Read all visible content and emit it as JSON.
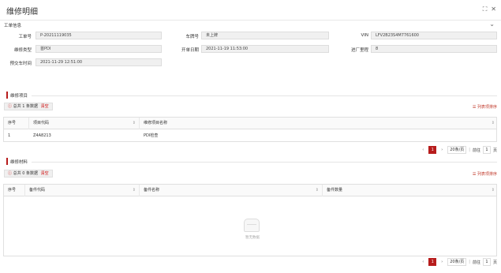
{
  "header": {
    "title": "维修明细"
  },
  "basic": {
    "section_title": "工单信息",
    "order_no_label": "工单号",
    "order_no": "P-20211119035",
    "plate_label": "车牌号",
    "plate": "未上牌",
    "vin_label": "VIN",
    "vin": "LFV2B23S4M7761600",
    "repair_type_label": "维修类型",
    "repair_type": "首PDI",
    "open_date_label": "开单日期",
    "open_date": "2021-11-19 11:53:00",
    "mileage_label": "进厂里程",
    "mileage": "8",
    "delivery_label": "预交车时间",
    "delivery": "2021-11-29 12:51:00"
  },
  "items": {
    "title": "维修项目",
    "summary_prefix": "总共 1 条数据",
    "clear": "清空",
    "col_setting": "列表项排序",
    "columns": [
      "序号",
      "项目代码",
      "维修项目名称"
    ],
    "rows": [
      {
        "no": "1",
        "code": "Z4A8213",
        "name": "PDI检查"
      }
    ],
    "pager": {
      "page": "1",
      "size": "20条/页",
      "goto": "前往",
      "goto_page": "1",
      "unit": "页"
    }
  },
  "parts": {
    "title": "维修材料",
    "summary_prefix": "总共 0 条数据",
    "clear": "清空",
    "col_setting": "列表项排序",
    "columns": [
      "序号",
      "备件代码",
      "备件名称",
      "备件数量"
    ],
    "empty_text": "暂无数据",
    "pager": {
      "page": "1",
      "size": "20条/页",
      "goto": "前往",
      "goto_page": "1",
      "unit": "页"
    }
  },
  "icons": {
    "fullscreen": "fullscreen-icon",
    "close": "close-icon",
    "collapse": "chevron-down-icon"
  },
  "colors": {
    "accent": "#b71c1c",
    "link": "#c0392b"
  }
}
